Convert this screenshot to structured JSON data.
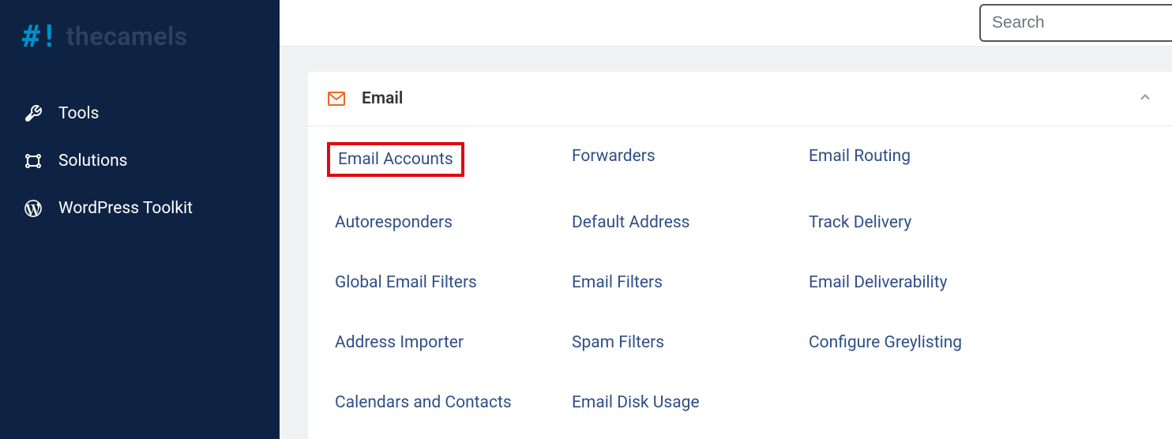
{
  "brand": {
    "icon_text": "#!",
    "name": "thecamels"
  },
  "sidebar": {
    "items": [
      {
        "label": "Tools"
      },
      {
        "label": "Solutions"
      },
      {
        "label": "WordPress Toolkit"
      }
    ]
  },
  "search": {
    "placeholder": "Search"
  },
  "panel": {
    "title": "Email",
    "links": [
      {
        "label": "Email Accounts",
        "highlighted": true
      },
      {
        "label": "Forwarders"
      },
      {
        "label": "Email Routing"
      },
      {
        "label": "Autoresponders"
      },
      {
        "label": "Default Address"
      },
      {
        "label": "Track Delivery"
      },
      {
        "label": "Global Email Filters"
      },
      {
        "label": "Email Filters"
      },
      {
        "label": "Email Deliverability"
      },
      {
        "label": "Address Importer"
      },
      {
        "label": "Spam Filters"
      },
      {
        "label": "Configure Greylisting"
      },
      {
        "label": "Calendars and Contacts"
      },
      {
        "label": "Email Disk Usage"
      }
    ]
  }
}
